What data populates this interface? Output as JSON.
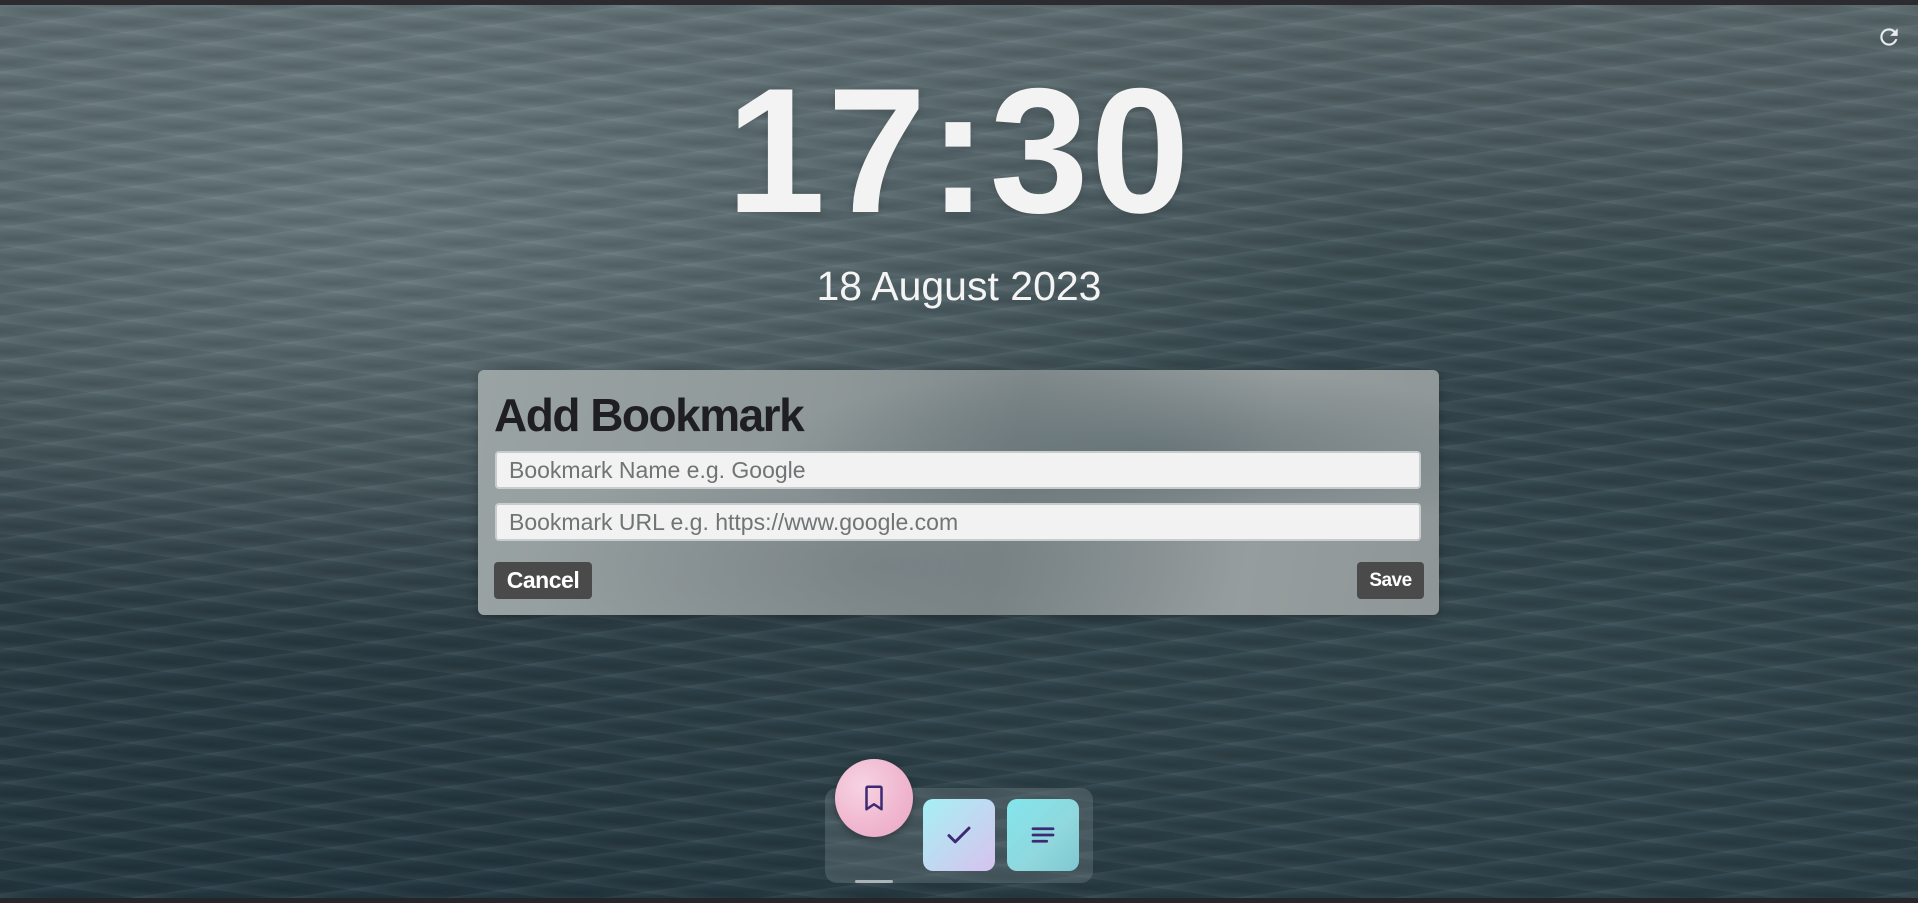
{
  "clock": {
    "time": "17:30",
    "date": "18 August 2023"
  },
  "bookmark_form": {
    "title": "Add Bookmark",
    "name_value": "",
    "name_placeholder": "Bookmark Name e.g. Google",
    "url_value": "",
    "url_placeholder": "Bookmark URL e.g. https://www.google.com",
    "cancel_label": "Cancel",
    "save_label": "Save"
  },
  "dock": {
    "items": [
      {
        "icon": "bookmark-icon",
        "active": true
      },
      {
        "icon": "checkmark-icon",
        "active": false
      },
      {
        "icon": "notes-icon",
        "active": false
      }
    ]
  },
  "toolbar": {
    "refresh_icon": "refresh-icon"
  },
  "colors": {
    "button_bg": "#4a4a4a",
    "title_text": "#1f1f22",
    "clock_text": "#f3f3f3",
    "icon_purple": "#3d2a73",
    "bookmark_button": "#f0b8d0",
    "todo_button": "#a6f0f4",
    "notes_button": "#83e6ec"
  }
}
